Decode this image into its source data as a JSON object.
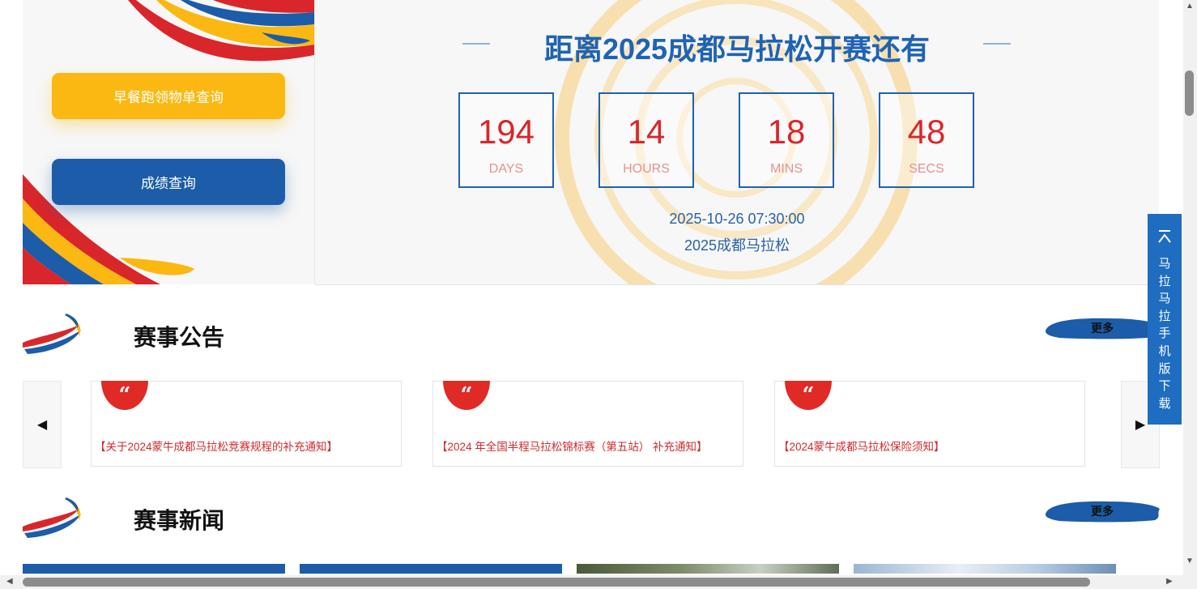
{
  "hero": {
    "breakfast_button": "早餐跑领物单查询",
    "score_button": "成绩查询"
  },
  "countdown": {
    "title": "距离2025成都马拉松开赛还有",
    "days": {
      "value": "194",
      "unit": "DAYS"
    },
    "hours": {
      "value": "14",
      "unit": "HOURS"
    },
    "mins": {
      "value": "18",
      "unit": "MINS"
    },
    "secs": {
      "value": "48",
      "unit": "SECS"
    },
    "date": "2025-10-26 07:30:00",
    "event": "2025成都马拉松"
  },
  "announcements": {
    "title": "赛事公告",
    "more": "更多",
    "items": [
      "【关于2024蒙牛成都马拉松竞赛规程的补充通知】",
      "【2024 年全国半程马拉松锦标赛（第五站） 补充通知】",
      "【2024蒙牛成都马拉松保险须知】"
    ]
  },
  "news": {
    "title": "赛事新闻",
    "more": "更多"
  },
  "app_float": {
    "label": "马拉马拉手机版下载",
    "icon": "to-top-icon"
  },
  "colors": {
    "brand_blue": "#1c5ca8",
    "brand_yellow": "#fbb812",
    "brand_red": "#d9262b"
  }
}
